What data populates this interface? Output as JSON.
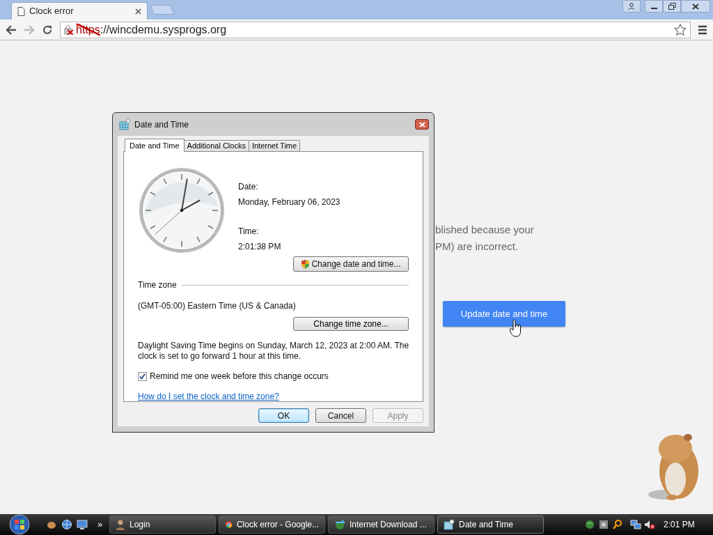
{
  "browser": {
    "tab_title": "Clock error",
    "address": {
      "scheme": "https",
      "rest": "://wincdemu.sysprogs.org",
      "insecure": true
    }
  },
  "page": {
    "message_lines": [
      "blished because your",
      "PM) are incorrect."
    ],
    "button": "Update date and time"
  },
  "dialog": {
    "title": "Date and Time",
    "tabs": [
      {
        "label": "Date and Time",
        "selected": true
      },
      {
        "label": "Additional Clocks",
        "selected": false
      },
      {
        "label": "Internet Time",
        "selected": false
      }
    ],
    "date_label": "Date:",
    "date": "Monday, February 06, 2023",
    "time_label": "Time:",
    "time": "2:01:38 PM",
    "change_datetime_button": "Change date and time...",
    "timezone_heading": "Time zone",
    "timezone": "(GMT-05:00) Eastern Time (US & Canada)",
    "change_timezone_button": "Change time zone...",
    "dst_note": "Daylight Saving Time begins on Sunday, March 12, 2023 at 2:00 AM. The clock is set to go forward 1 hour at this time.",
    "reminder": {
      "label": "Remind me one week before this change occurs",
      "checked": true
    },
    "help_link": "How do I set the clock and time zone?",
    "buttons": [
      {
        "label": "OK",
        "kind": "default",
        "disabled": false
      },
      {
        "label": "Cancel",
        "kind": "normal",
        "disabled": false
      },
      {
        "label": "Apply",
        "kind": "normal",
        "disabled": true
      }
    ]
  },
  "taskbar": {
    "overflow": "»",
    "items": [
      {
        "label": "Login",
        "kind": "user",
        "selected": false
      },
      {
        "label": "Clock error - Google...",
        "kind": "browser",
        "selected": false
      },
      {
        "label": "Internet Download ...",
        "kind": "downloader",
        "selected": false
      },
      {
        "label": "Date and Time",
        "kind": "calendar",
        "selected": true
      }
    ],
    "clock": "2:01 PM"
  }
}
